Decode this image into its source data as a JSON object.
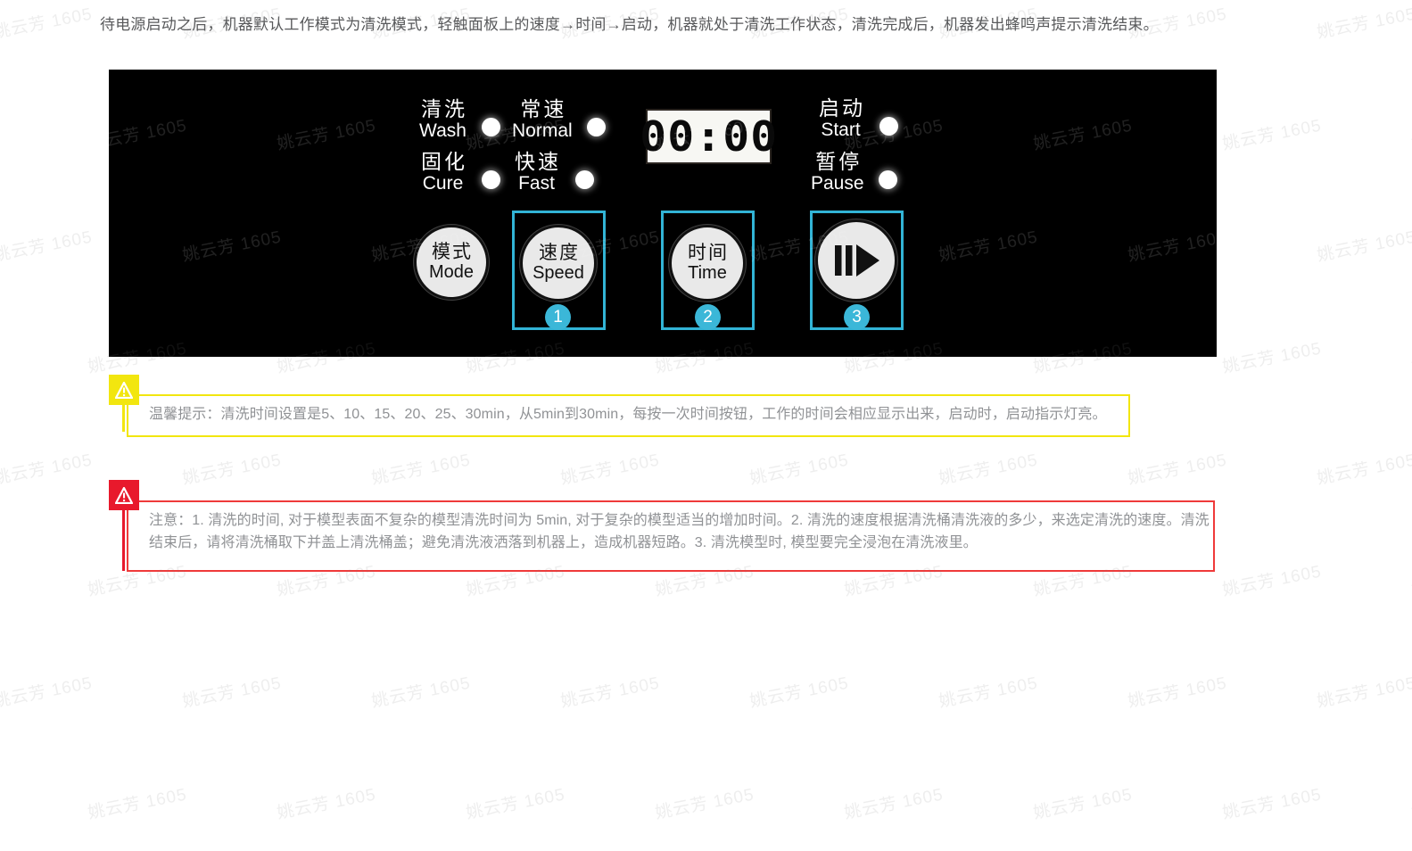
{
  "intro": {
    "text": "待电源启动之后，机器默认工作模式为清洗模式，轻触面板上的速度→时间→启动，机器就处于清洗工作状态，清洗完成后，机器发出蜂鸣声提示清洗结束。"
  },
  "panel": {
    "indicators": [
      {
        "cn": "清洗",
        "en": "Wash",
        "led": "led-indicator"
      },
      {
        "cn": "固化",
        "en": "Cure",
        "led": "led-indicator"
      },
      {
        "cn": "常速",
        "en": "Normal",
        "led": "led-indicator"
      },
      {
        "cn": "快速",
        "en": "Fast",
        "led": "led-indicator"
      },
      {
        "cn": "启动",
        "en": "Start",
        "led": "led-indicator"
      },
      {
        "cn": "暂停",
        "en": "Pause",
        "led": "led-indicator"
      }
    ],
    "display": {
      "value": "00:00"
    },
    "buttons": [
      {
        "cn": "模式",
        "en": "Mode",
        "step": "",
        "highlighted": false,
        "icon": ""
      },
      {
        "cn": "速度",
        "en": "Speed",
        "step": "1",
        "highlighted": true,
        "icon": ""
      },
      {
        "cn": "时间",
        "en": "Time",
        "step": "2",
        "highlighted": true,
        "icon": ""
      },
      {
        "cn": "",
        "en": "",
        "step": "3",
        "highlighted": true,
        "icon": "play-pause-icon"
      }
    ],
    "accent_color": "#32b4d6",
    "background_color": "#000000"
  },
  "warning": {
    "icon": "warning-triangle-icon",
    "color": "#f2e60f",
    "text": "温馨提示：清洗时间设置是5、10、15、20、25、30min，从5min到30min，每按一次时间按钮，工作的时间会相应显示出来，启动时，启动指示灯亮。"
  },
  "notice": {
    "icon": "warning-triangle-icon",
    "color": "#e8192c",
    "line1": "注意：1. 清洗的时间, 对于模型表面不复杂的模型清洗时间为 5min, 对于复杂的模型适当的增加时间。2. 清洗的速度根据清洗桶清洗液的多少，来选定清洗的速度。清洗",
    "line2": "结束后，请将清洗桶取下并盖上清洗桶盖；避免清洗液洒落到机器上，造成机器短路。3. 清洗模型时, 模型要完全浸泡在清洗液里。"
  },
  "watermark": {
    "text": "姚云芳 1605"
  }
}
